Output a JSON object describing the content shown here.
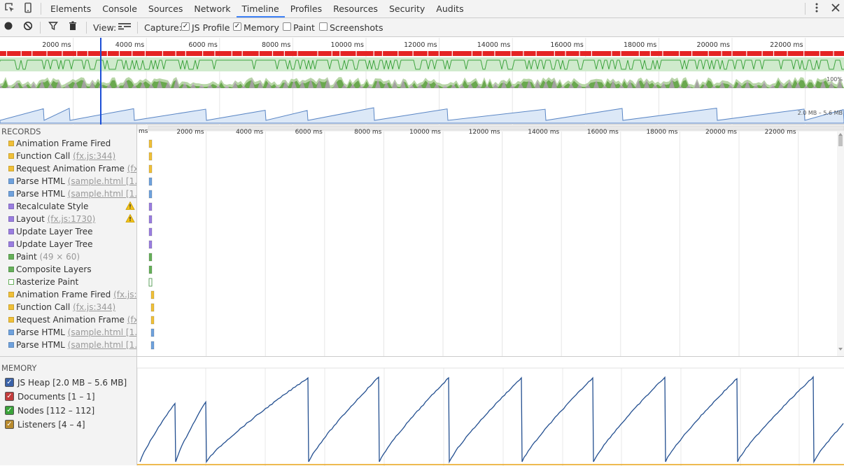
{
  "tabbar": {
    "tabs": [
      "Elements",
      "Console",
      "Sources",
      "Network",
      "Timeline",
      "Profiles",
      "Resources",
      "Security",
      "Audits"
    ],
    "active_tab": "Timeline",
    "icons": [
      "inspect-element-icon",
      "device-mode-icon",
      "more-menu-icon",
      "close-icon"
    ]
  },
  "toolbar": {
    "record_icon": "record-icon",
    "clear_icon": "clear-icon",
    "filter_icon": "filter-icon",
    "trash_icon": "garbage-collect-icon",
    "view_label": "View:",
    "view_mode_icon": "flame-chart-view-icon",
    "capture_label": "Capture:",
    "capture_options": [
      {
        "label": "JS Profile",
        "checked": true
      },
      {
        "label": "Memory",
        "checked": true
      },
      {
        "label": "Paint",
        "checked": false
      },
      {
        "label": "Screenshots",
        "checked": false
      }
    ]
  },
  "overview": {
    "time_ticks": [
      "2000 ms",
      "4000 ms",
      "6000 ms",
      "8000 ms",
      "10000 ms",
      "12000 ms",
      "14000 ms",
      "16000 ms",
      "18000 ms",
      "20000 ms",
      "22000 ms"
    ],
    "cpu_label": "100%",
    "memory_range_label": "2.0 MB – 5.6 MB"
  },
  "records": {
    "title": "RECORDS",
    "ruler_start": "ms",
    "ruler_ticks": [
      "2000 ms",
      "4000 ms",
      "6000 ms",
      "8000 ms",
      "10000 ms",
      "12000 ms",
      "14000 ms",
      "16000 ms",
      "18000 ms",
      "20000 ms",
      "22000 ms",
      "24"
    ],
    "items": [
      {
        "label": "Animation Frame Fired",
        "hint": "",
        "color": "#f0c038",
        "warning": false
      },
      {
        "label": "Function Call",
        "hint": "(fx.js:344)",
        "color": "#f0c038",
        "warning": false
      },
      {
        "label": "Request Animation Frame",
        "hint": "(fx...",
        "color": "#f0c038",
        "warning": false
      },
      {
        "label": "Parse HTML",
        "hint": "(sample.html [1...])",
        "color": "#6fa2dd",
        "warning": false
      },
      {
        "label": "Parse HTML",
        "hint": "(sample.html [1...])",
        "color": "#6fa2dd",
        "warning": false
      },
      {
        "label": "Recalculate Style",
        "hint": "",
        "color": "#9a7ee0",
        "warning": true
      },
      {
        "label": "Layout",
        "hint": "(fx.js:1730)",
        "color": "#9a7ee0",
        "warning": true
      },
      {
        "label": "Update Layer Tree",
        "hint": "",
        "color": "#9a7ee0",
        "warning": false
      },
      {
        "label": "Update Layer Tree",
        "hint": "",
        "color": "#9a7ee0",
        "warning": false
      },
      {
        "label": "Paint",
        "hint": "(49 × 60)",
        "color": "#66b05a",
        "warning": false
      },
      {
        "label": "Composite Layers",
        "hint": "",
        "color": "#66b05a",
        "warning": false
      },
      {
        "label": "Rasterize Paint",
        "hint": "",
        "color": "#ffffff",
        "warning": false
      },
      {
        "label": "Animation Frame Fired",
        "hint": "(fx.js:3...",
        "color": "#f0c038",
        "warning": false
      },
      {
        "label": "Function Call",
        "hint": "(fx.js:344)",
        "color": "#f0c038",
        "warning": false
      },
      {
        "label": "Request Animation Frame",
        "hint": "(fx...",
        "color": "#f0c038",
        "warning": false
      },
      {
        "label": "Parse HTML",
        "hint": "(sample.html [1...])",
        "color": "#6fa2dd",
        "warning": false
      },
      {
        "label": "Parse HTML",
        "hint": "(sample.html [1...])",
        "color": "#6fa2dd",
        "warning": false
      }
    ]
  },
  "memory": {
    "title": "MEMORY",
    "counters": [
      {
        "label": "JS Heap [2.0 MB – 5.6 MB]",
        "color": "#3a62a8",
        "checked": true
      },
      {
        "label": "Documents [1 – 1]",
        "color": "#c23b3b",
        "checked": true
      },
      {
        "label": "Nodes [112 – 112]",
        "color": "#3aa33a",
        "checked": true
      },
      {
        "label": "Listeners [4 – 4]",
        "color": "#b88a2e",
        "checked": true
      }
    ]
  }
}
